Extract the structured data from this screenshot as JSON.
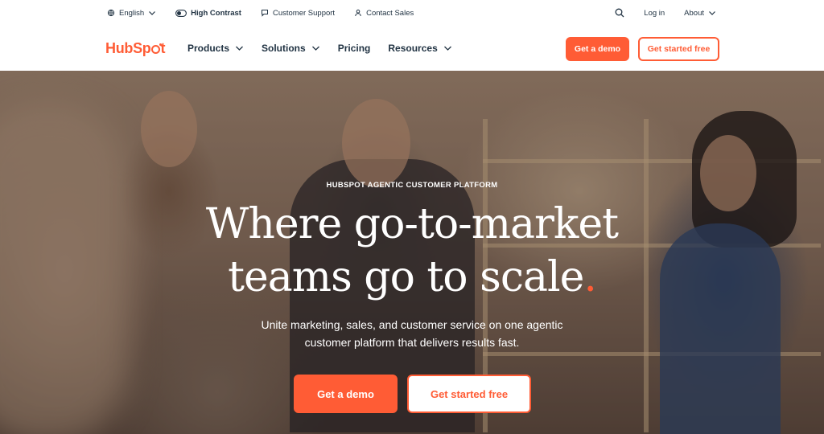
{
  "utility": {
    "language": "English",
    "high_contrast": "High Contrast",
    "customer_support": "Customer Support",
    "contact_sales": "Contact Sales",
    "login": "Log in",
    "about": "About"
  },
  "brand": {
    "name": "HubSpot",
    "color": "#ff5c35"
  },
  "nav": {
    "items": [
      {
        "label": "Products",
        "has_dropdown": true
      },
      {
        "label": "Solutions",
        "has_dropdown": true
      },
      {
        "label": "Pricing",
        "has_dropdown": false
      },
      {
        "label": "Resources",
        "has_dropdown": true
      }
    ],
    "demo_label": "Get a demo",
    "free_label": "Get started free"
  },
  "hero": {
    "eyebrow": "HUBSPOT AGENTIC CUSTOMER PLATFORM",
    "headline_line1": "Where go-to-market",
    "headline_line2": "teams go to scale",
    "headline_dot": ".",
    "subline_line1": "Unite marketing, sales, and customer service on one agentic",
    "subline_line2": "customer platform that delivers results fast.",
    "demo_label": "Get a demo",
    "free_label": "Get started free"
  },
  "colors": {
    "accent": "#ff5c35",
    "text": "#213343"
  },
  "icons": [
    "globe-icon",
    "toggle-icon",
    "chat-icon",
    "person-icon",
    "search-icon",
    "chevron-down-icon"
  ]
}
